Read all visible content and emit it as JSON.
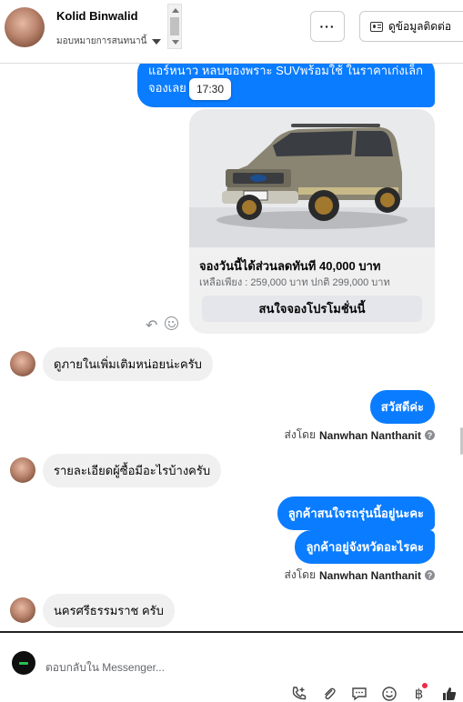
{
  "header": {
    "contact_name": "Kolid Binwalid",
    "assign_label": "มอบหมายการสนทนานี้",
    "more_label": "···",
    "contact_info_label": "ดูข้อมูลติดต่อ"
  },
  "messages": {
    "promo_text": "แอร์หนาว หลบของพราะ SUVพร้อมใช้ ในราคาเก่งเล็ก จองเลย",
    "tooltip_time": "17:30",
    "card": {
      "title": "จองวันนี้ได้ส่วนลดทันที 40,000 บาท",
      "subtitle": "เหลือเพียง : 259,000 บาท ปกติ 299,000 บาท",
      "button_label": "สนใจจองโปรโมชั่นนี้"
    },
    "in_1": "ดูภายในเพิ่มเติมหน่อยน่ะครับ",
    "out_1": "สวัสดีค่ะ",
    "sent_by_label": "ส่งโดย",
    "sent_by_name": "Nanwhan Nanthanit",
    "in_2": "รายละเอียดผู้ซื้อมีอะไรบ้างครับ",
    "out_2": "ลูกค้าสนใจรถรุ่นนี้อยู่นะคะ",
    "out_3": "ลูกค้าอยู่จังหวัดอะไรคะ",
    "in_3": "นครศรีธรรมราช ครับ"
  },
  "composer": {
    "placeholder": "ตอบกลับใน Messenger..."
  },
  "colors": {
    "outgoing_bubble": "#0a7cff",
    "incoming_bubble": "#f0f0f0"
  }
}
